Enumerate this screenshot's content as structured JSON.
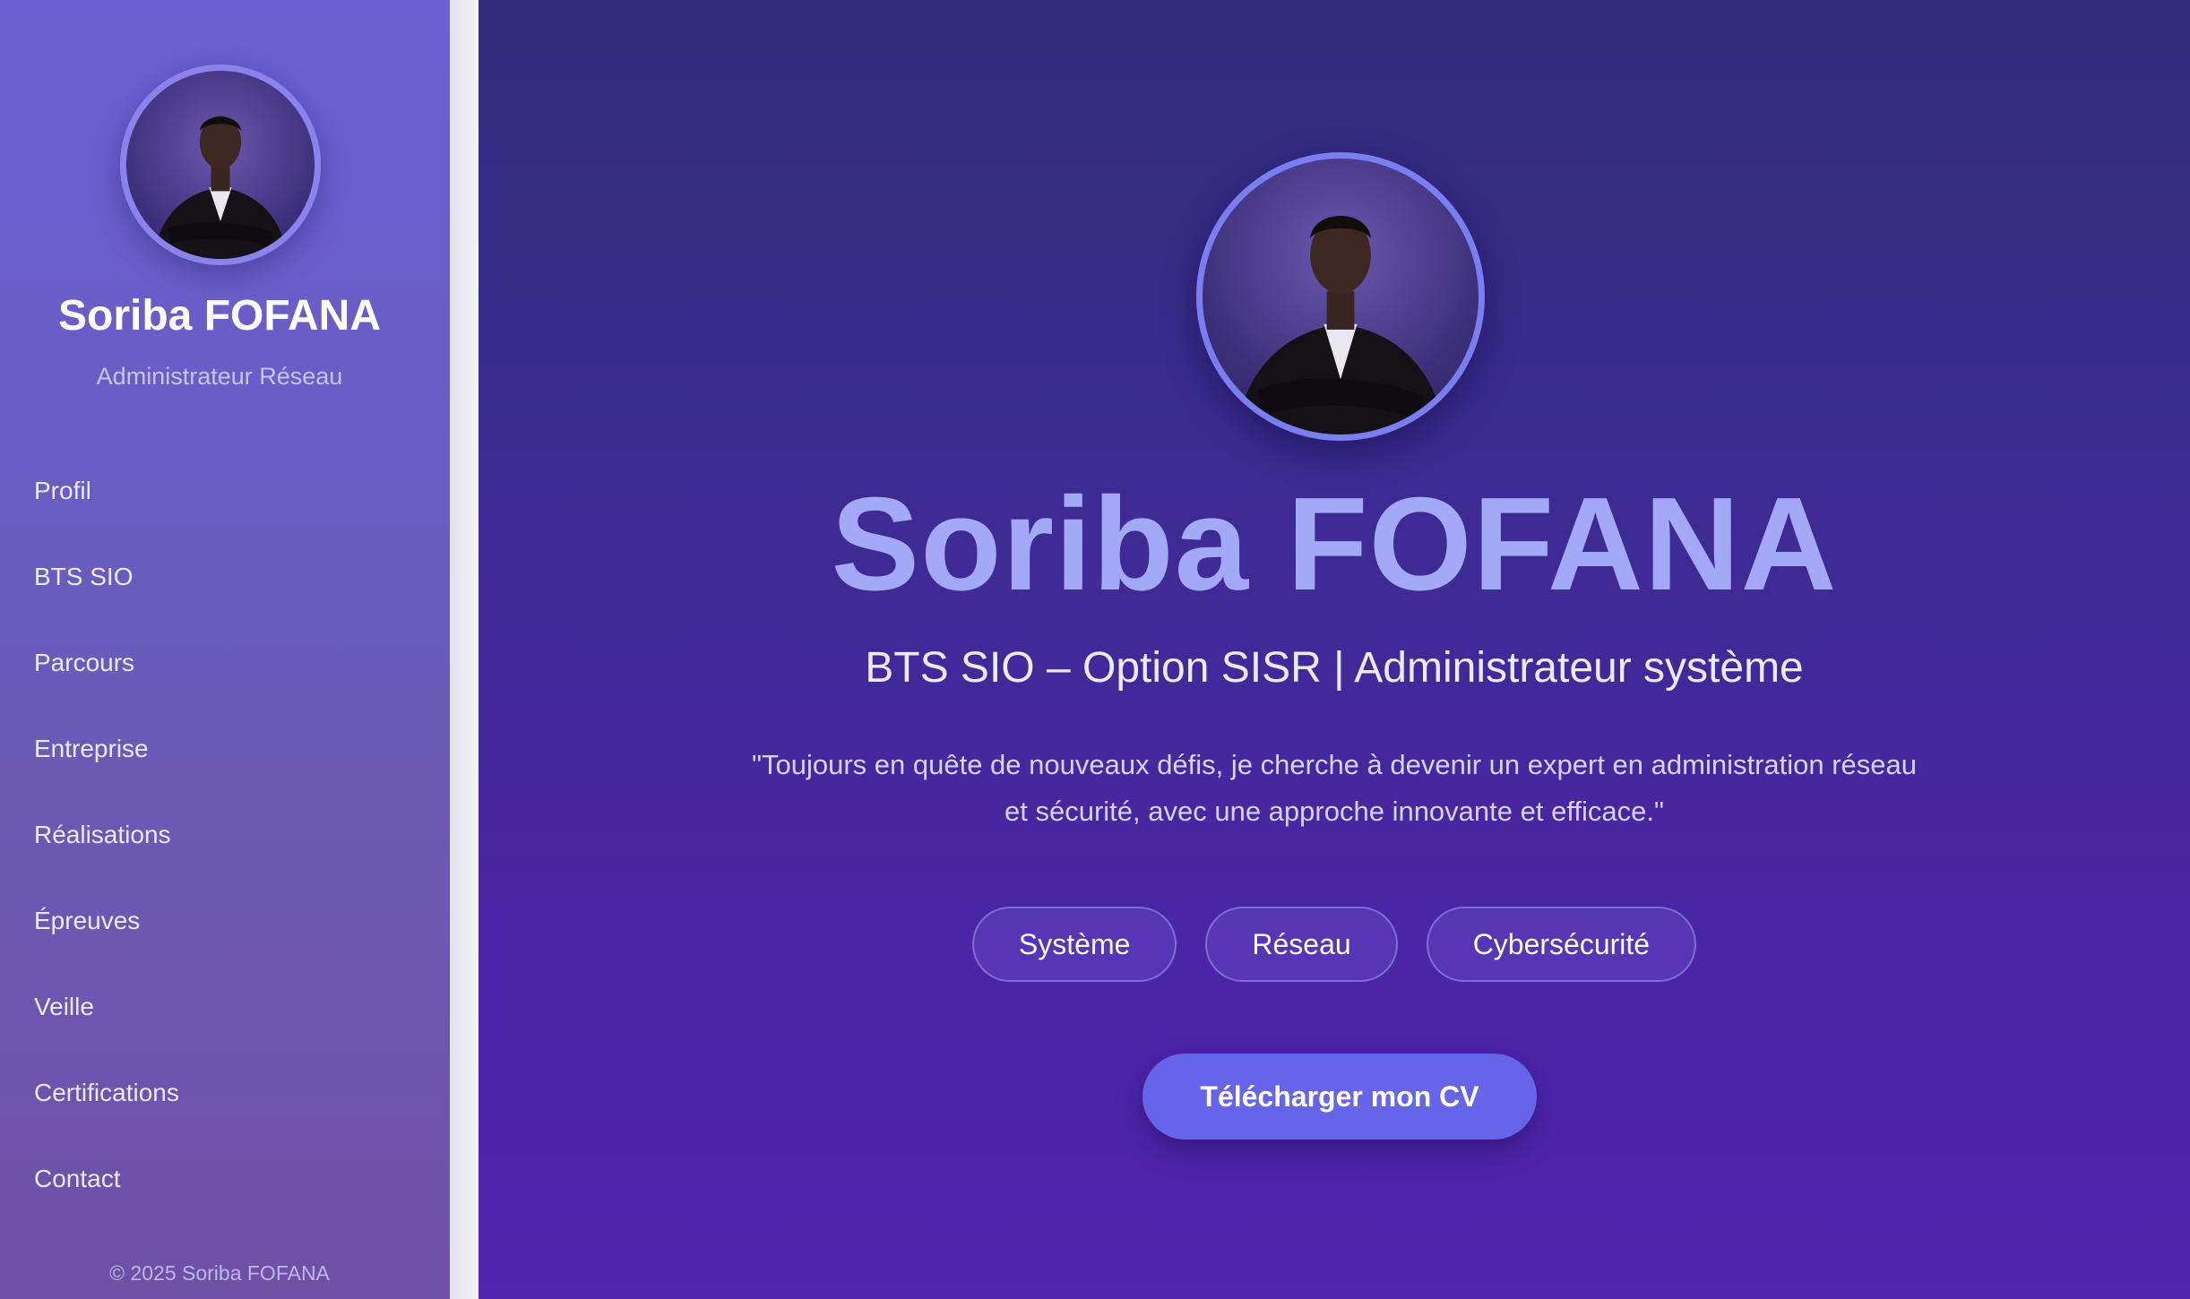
{
  "sidebar": {
    "name": "Soriba FOFANA",
    "role": "Administrateur Réseau",
    "nav": [
      {
        "label": "Profil"
      },
      {
        "label": "BTS SIO"
      },
      {
        "label": "Parcours"
      },
      {
        "label": "Entreprise"
      },
      {
        "label": "Réalisations"
      },
      {
        "label": "Épreuves"
      },
      {
        "label": "Veille"
      },
      {
        "label": "Certifications"
      },
      {
        "label": "Contact"
      }
    ],
    "footer": "© 2025 Soriba FOFANA"
  },
  "hero": {
    "title": "Soriba FOFANA",
    "subtitle": "BTS SIO – Option SISR | Administrateur système",
    "quote": "\"Toujours en quête de nouveaux défis, je cherche à devenir un expert en administration réseau et sécurité, avec une approche innovante et efficace.\"",
    "tags": [
      {
        "label": "Système"
      },
      {
        "label": "Réseau"
      },
      {
        "label": "Cybersécurité"
      }
    ],
    "cv_button": "Télécharger mon CV"
  },
  "colors": {
    "sidebar_top": "#6a5fd4",
    "main_top": "#312c7b",
    "main_bottom": "#5324ad",
    "title_accent": "#a3a9f7",
    "button": "#6664e8"
  },
  "icons": {
    "avatar": "profile-photo"
  }
}
